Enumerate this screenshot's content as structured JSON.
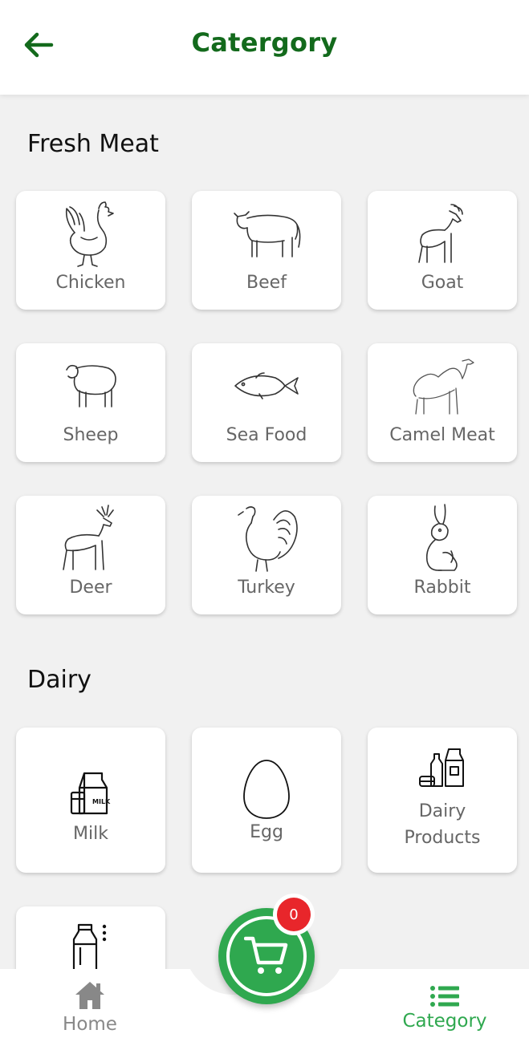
{
  "header": {
    "title": "Catergory"
  },
  "sections": [
    {
      "title": "Fresh Meat"
    },
    {
      "title": "Dairy"
    }
  ],
  "fresh_meat": [
    {
      "label": "Chicken",
      "icon": "chicken-icon"
    },
    {
      "label": "Beef",
      "icon": "cow-icon"
    },
    {
      "label": "Goat",
      "icon": "goat-icon"
    },
    {
      "label": "Sheep",
      "icon": "sheep-icon"
    },
    {
      "label": "Sea Food",
      "icon": "fish-icon"
    },
    {
      "label": "Camel Meat",
      "icon": "camel-icon"
    },
    {
      "label": "Deer",
      "icon": "deer-icon"
    },
    {
      "label": "Turkey",
      "icon": "turkey-icon"
    },
    {
      "label": "Rabbit",
      "icon": "rabbit-icon"
    }
  ],
  "dairy": [
    {
      "label": "Milk",
      "icon": "milk-carton-icon"
    },
    {
      "label": "Egg",
      "icon": "egg-icon"
    },
    {
      "label": "Dairy Products",
      "icon": "dairy-products-icon"
    },
    {
      "label": "",
      "icon": "milk-bottle-icon"
    }
  ],
  "cart": {
    "count": "0"
  },
  "bottom_nav": {
    "home": {
      "label": "Home",
      "color": "#888888"
    },
    "category": {
      "label": "Category",
      "color": "#2fa84f"
    }
  },
  "colors": {
    "accent": "#136a1c",
    "fab": "#2fa84f",
    "badge": "#e8262b"
  }
}
